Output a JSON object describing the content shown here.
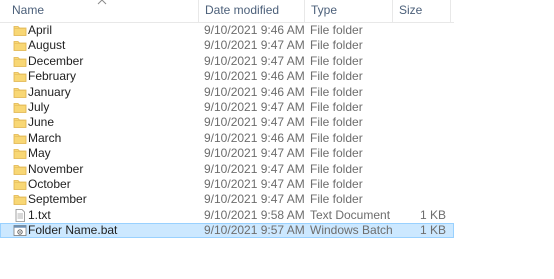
{
  "columns": {
    "name": "Name",
    "date_modified": "Date modified",
    "type": "Type",
    "size": "Size"
  },
  "colors": {
    "folder": "#f8d775",
    "selection": "#cce8ff",
    "selection_border": "#99d1ff",
    "header_text": "#4c607a"
  },
  "rows": [
    {
      "icon": "folder-icon",
      "name": "April",
      "date": "9/10/2021 9:46 AM",
      "type": "File folder",
      "size": ""
    },
    {
      "icon": "folder-icon",
      "name": "August",
      "date": "9/10/2021 9:47 AM",
      "type": "File folder",
      "size": ""
    },
    {
      "icon": "folder-icon",
      "name": "December",
      "date": "9/10/2021 9:47 AM",
      "type": "File folder",
      "size": ""
    },
    {
      "icon": "folder-icon",
      "name": "February",
      "date": "9/10/2021 9:46 AM",
      "type": "File folder",
      "size": ""
    },
    {
      "icon": "folder-icon",
      "name": "January",
      "date": "9/10/2021 9:46 AM",
      "type": "File folder",
      "size": ""
    },
    {
      "icon": "folder-icon",
      "name": "July",
      "date": "9/10/2021 9:47 AM",
      "type": "File folder",
      "size": ""
    },
    {
      "icon": "folder-icon",
      "name": "June",
      "date": "9/10/2021 9:47 AM",
      "type": "File folder",
      "size": ""
    },
    {
      "icon": "folder-icon",
      "name": "March",
      "date": "9/10/2021 9:46 AM",
      "type": "File folder",
      "size": ""
    },
    {
      "icon": "folder-icon",
      "name": "May",
      "date": "9/10/2021 9:47 AM",
      "type": "File folder",
      "size": ""
    },
    {
      "icon": "folder-icon",
      "name": "November",
      "date": "9/10/2021 9:47 AM",
      "type": "File folder",
      "size": ""
    },
    {
      "icon": "folder-icon",
      "name": "October",
      "date": "9/10/2021 9:47 AM",
      "type": "File folder",
      "size": ""
    },
    {
      "icon": "folder-icon",
      "name": "September",
      "date": "9/10/2021 9:47 AM",
      "type": "File folder",
      "size": ""
    },
    {
      "icon": "text-file-icon",
      "name": "1.txt",
      "date": "9/10/2021 9:58 AM",
      "type": "Text Document",
      "size": "1 KB"
    },
    {
      "icon": "batch-file-icon",
      "name": "Folder Name.bat",
      "date": "9/10/2021 9:57 AM",
      "type": "Windows Batch File",
      "size": "1 KB",
      "selected": true
    }
  ]
}
